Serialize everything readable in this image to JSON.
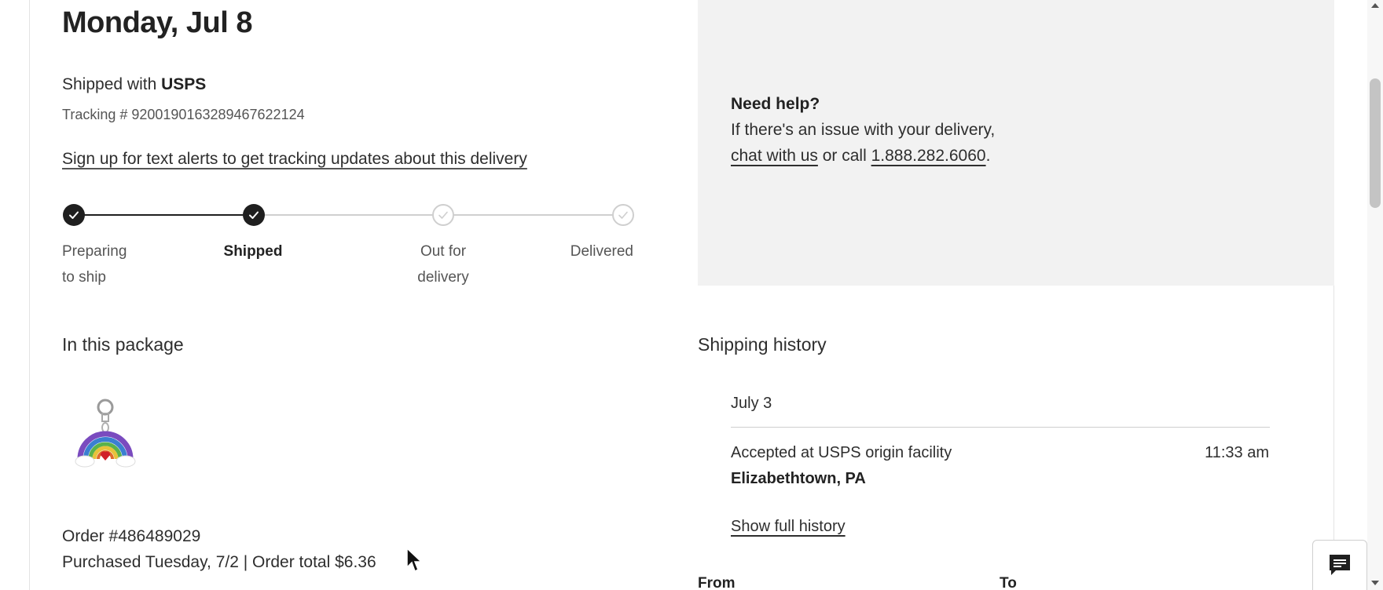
{
  "delivery": {
    "date": "Monday, Jul 8",
    "shipped_prefix": "Shipped with ",
    "carrier": "USPS",
    "tracking": "Tracking # 9200190163289467622124",
    "alerts_link": "Sign up for text alerts to get tracking updates about this delivery"
  },
  "progress": {
    "current_step": 2,
    "steps": [
      {
        "label": "Preparing\nto ship",
        "state": "done",
        "icon": "check-icon"
      },
      {
        "label": "Shipped",
        "state": "done",
        "icon": "check-icon"
      },
      {
        "label": "Out for\ndelivery",
        "state": "pending",
        "icon": "check-icon"
      },
      {
        "label": "Delivered",
        "state": "pending",
        "icon": "check-icon"
      }
    ]
  },
  "package": {
    "heading": "In this package",
    "item_icon": "rainbow-charm-image",
    "order_number": "Order #486489029",
    "order_meta": "Purchased Tuesday, 7/2 | Order total $6.36"
  },
  "help": {
    "title": "Need help?",
    "line1": "If there's an issue with your delivery,",
    "chat_link": "chat with us",
    "middle": " or call ",
    "phone": "1.888.282.6060",
    "end": "."
  },
  "shipping_history": {
    "heading": "Shipping history",
    "date": "July 3",
    "event": "Accepted at USPS origin facility",
    "time": "11:33 am",
    "location": "Elizabethtown, PA",
    "full_history_link": "Show full history",
    "from_label": "From",
    "to_label": "To"
  },
  "chat_icon": "chat-bubble-icon",
  "colors": {
    "done_node": "#1f1f1f",
    "pending_node": "#cfcfcf",
    "help_bg": "#f2f2f2",
    "text": "#2e2e2e"
  }
}
